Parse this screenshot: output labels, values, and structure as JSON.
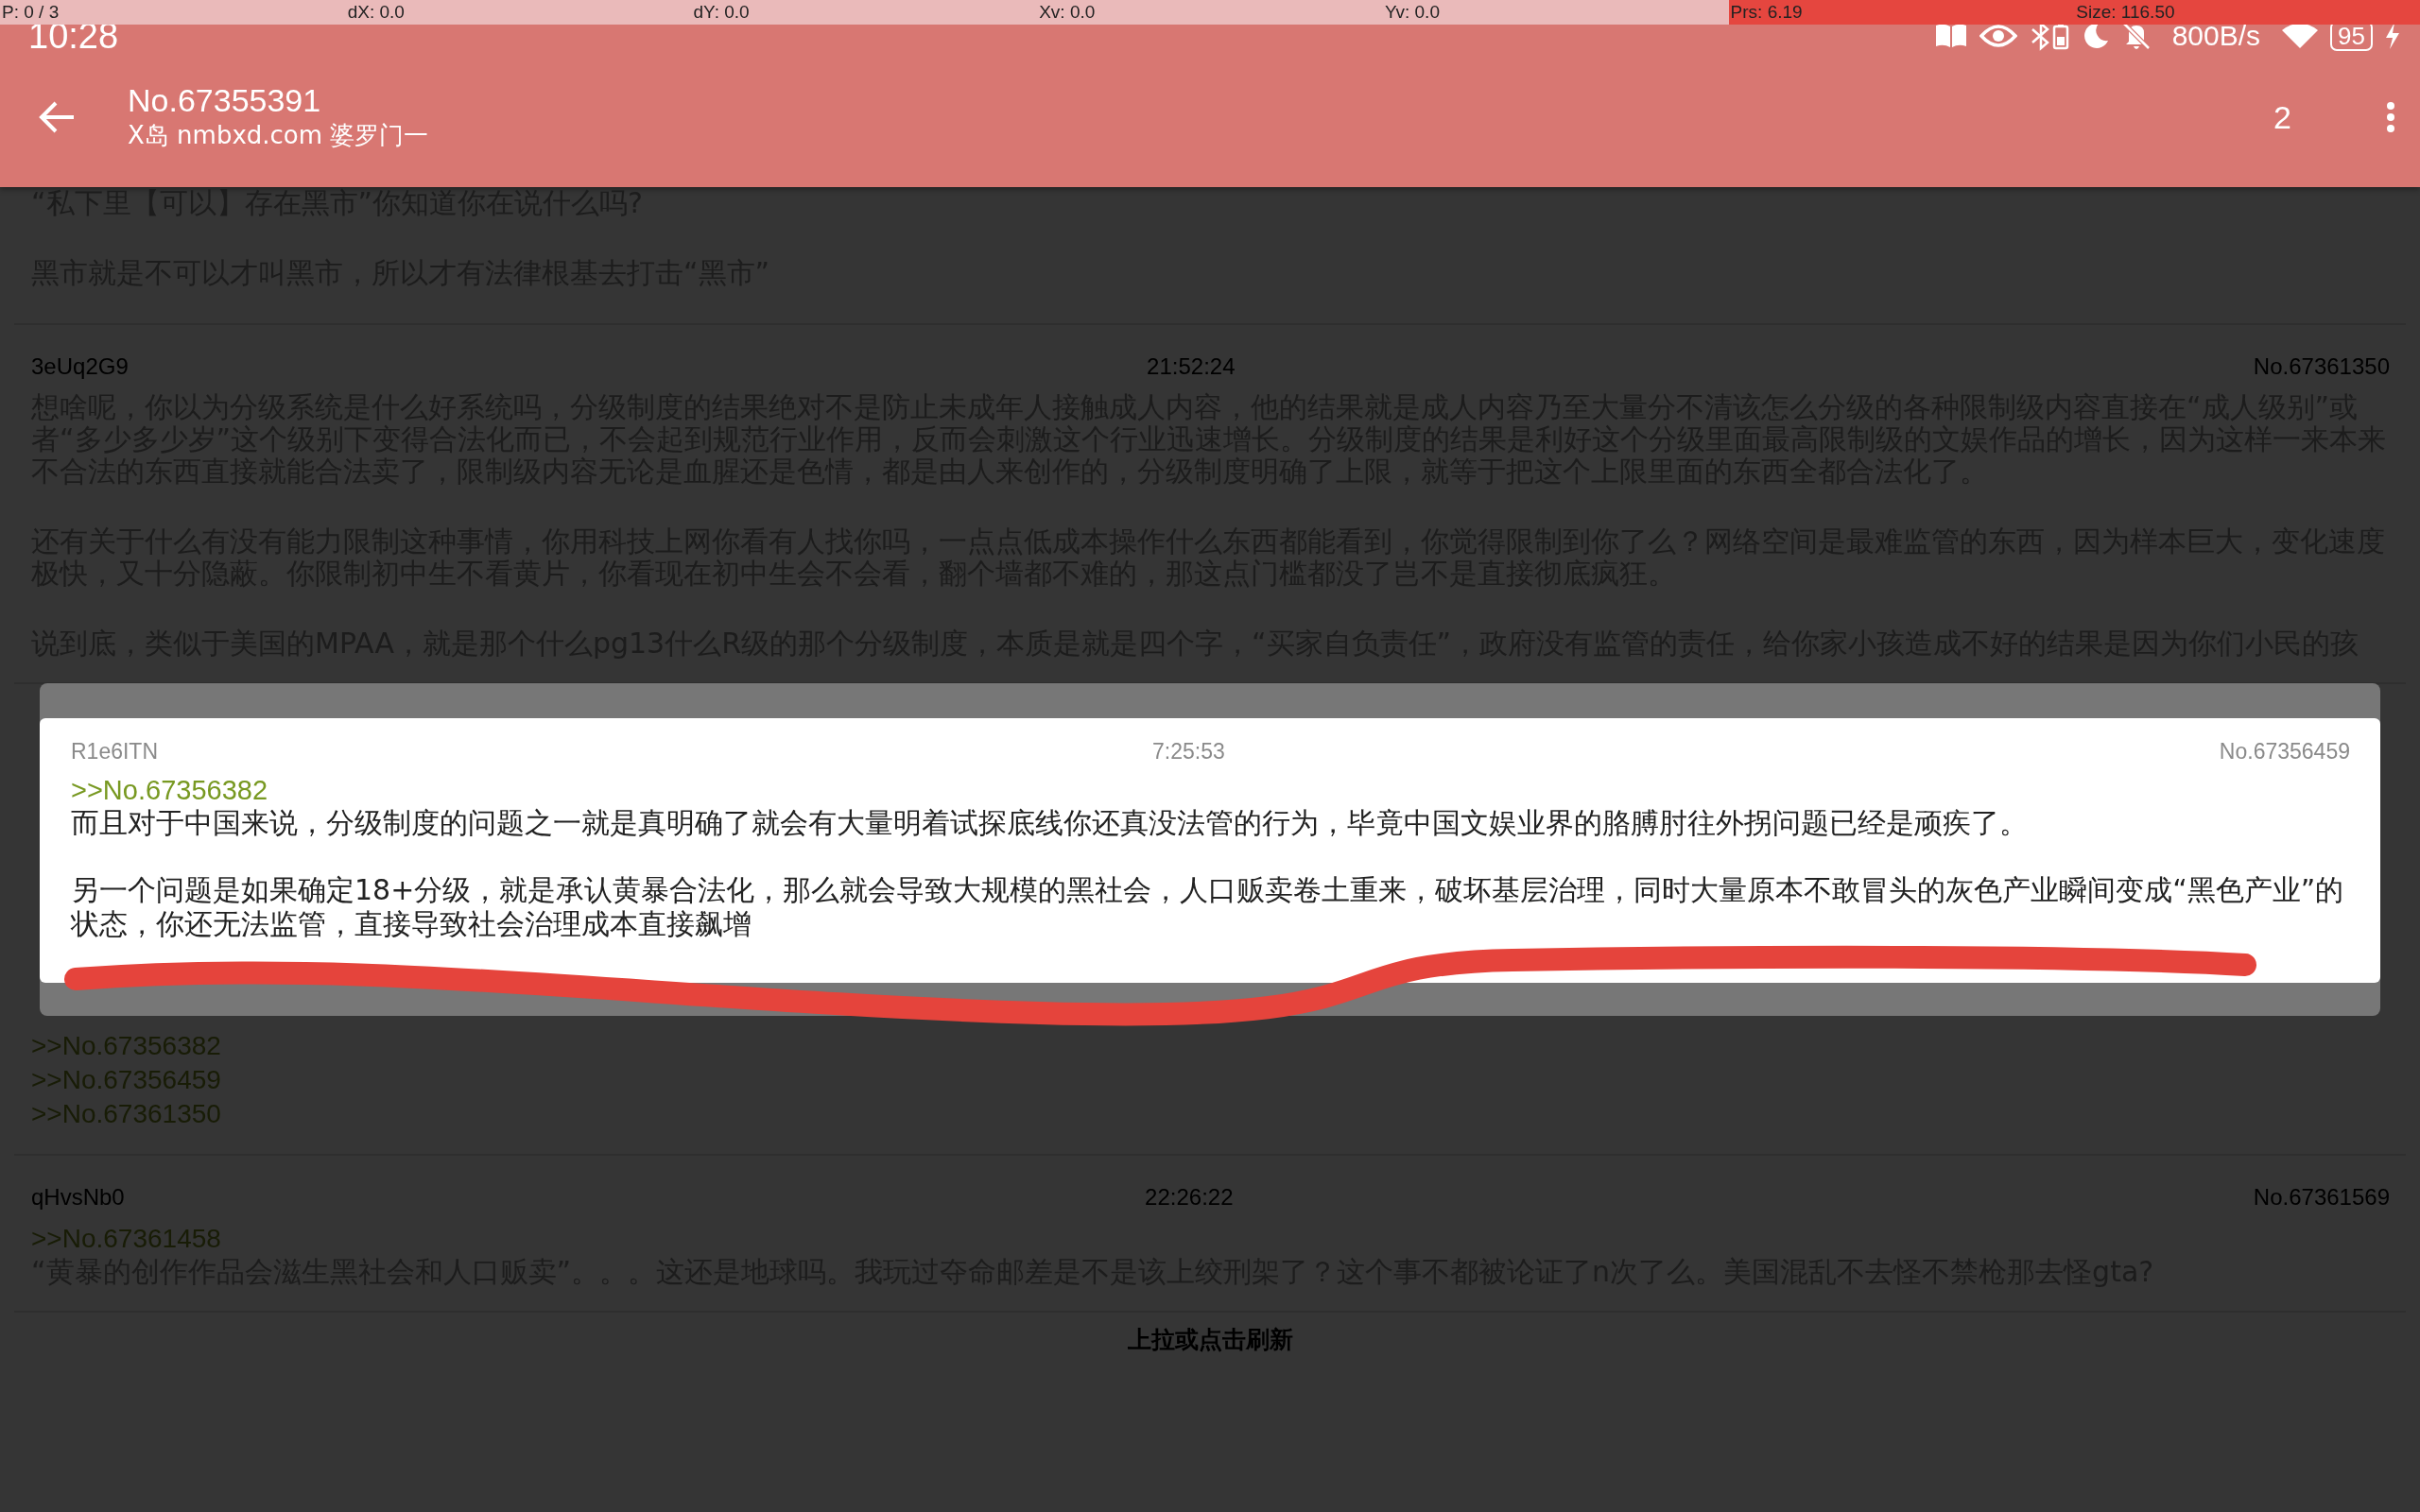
{
  "debug_bar": [
    {
      "label": "P: 0 / 3",
      "highlighted": false
    },
    {
      "label": "dX: 0.0",
      "highlighted": false
    },
    {
      "label": "dY: 0.0",
      "highlighted": false
    },
    {
      "label": "Xv: 0.0",
      "highlighted": false
    },
    {
      "label": "Yv: 0.0",
      "highlighted": false
    },
    {
      "label": "Prs: 6.19",
      "highlighted": true
    },
    {
      "label": "Size: 116.50",
      "highlighted": true
    }
  ],
  "status_bar": {
    "time": "10:28",
    "network_speed": "800B/s",
    "battery": "95"
  },
  "toolbar": {
    "title": "No.67355391",
    "subtitle": "X岛 nmbxd.com 婆罗门一",
    "page_count": "2"
  },
  "posts": [
    {
      "paragraphs": [
        "“私下里【可以】存在黑市”你知道你在说什么吗?",
        "黑市就是不可以才叫黑市，所以才有法律根基去打击“黑市”"
      ]
    },
    {
      "user": "3eUq2G9",
      "time": "21:52:24",
      "number": "No.67361350",
      "paragraphs": [
        "想啥呢，你以为分级系统是什么好系统吗，分级制度的结果绝对不是防止未成年人接触成人内容，他的结果就是成人内容乃至大量分不清该怎么分级的各种限制级内容直接在“成人级别”或者“多少多少岁”这个级别下变得合法化而已，不会起到规范行业作用，反而会刺激这个行业迅速增长。分级制度的结果是利好这个分级里面最高限制级的文娱作品的增长，因为这样一来本来不合法的东西直接就能合法卖了，限制级内容无论是血腥还是色情，都是由人来创作的，分级制度明确了上限，就等于把这个上限里面的东西全都合法化了。",
        "还有关于什么有没有能力限制这种事情，你用科技上网你看有人找你吗，一点点低成本操作什么东西都能看到，你觉得限制到你了么？网络空间是最难监管的东西，因为样本巨大，变化速度极快，又十分隐蔽。你限制初中生不看黄片，你看现在初中生会不会看，翻个墙都不难的，那这点门槛都没了岂不是直接彻底疯狂。",
        "说到底，类似于美国的MPAA，就是那个什么pg13什么R级的那个分级制度，本质是就是四个字，“买家自负责任”，政府没有监管的责任，给你家小孩造成不好的结果是因为你们小民的孩"
      ]
    },
    {
      "quotes": [
        ">>No.67356382",
        ">>No.67356459",
        ">>No.67361350"
      ]
    },
    {
      "user": "qHvsNb0",
      "time": "22:26:22",
      "number": "No.67361569",
      "quotes": [
        ">>No.67361458"
      ],
      "paragraphs": [
        "“黄暴的创作作品会滋生黑社会和人口贩卖”。。。这还是地球吗。我玩过夺命邮差是不是该上绞刑架了？这个事不都被论证了n次了么。美国混乱不去怪不禁枪那去怪gta?"
      ]
    }
  ],
  "footer": "上拉或点击刷新",
  "popup": {
    "user": "R1e6ITN",
    "time": "7:25:53",
    "number": "No.67356459",
    "quotes": [
      ">>No.67356382"
    ],
    "paragraphs": [
      "而且对于中国来说，分级制度的问题之一就是真明确了就会有大量明着试探底线你还真没法管的行为，毕竟中国文娱业界的胳膊肘往外拐问题已经是顽疾了。",
      "另一个问题是如果确定18+分级，就是承认黄暴合法化，那么就会导致大规模的黑社会，人口贩卖卷土重来，破坏基层治理，同时大量原本不敢冒头的灰色产业瞬间变成“黑色产业”的状态，你还无法监管，直接导致社会治理成本直接飙增"
    ]
  }
}
